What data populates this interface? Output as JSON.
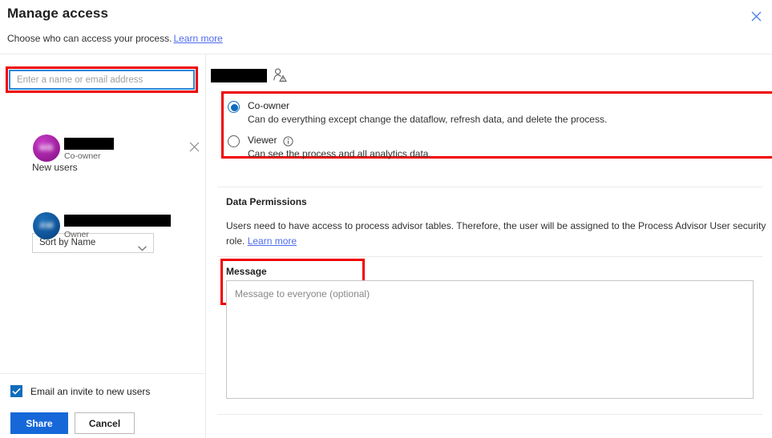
{
  "header": {
    "title": "Manage access",
    "subtitle": "Choose who can access your process.",
    "subtitle_link": "Learn more",
    "close_icon": "close-icon"
  },
  "left_panel": {
    "search": {
      "placeholder": "Enter a name or email address",
      "value": ""
    },
    "new_users_label": "New users",
    "new_users": [
      {
        "avatar_initials": "MB",
        "avatar_color": "#a020a0",
        "name_redacted": true,
        "name_redaction_width": 62,
        "role": "Co-owner",
        "remove_icon": "close-icon"
      }
    ],
    "sort": {
      "selected": "Sort by Name",
      "chevron_icon": "chevron-down-icon"
    },
    "existing_users": [
      {
        "avatar_initials": "AM",
        "avatar_color": "#0f5499",
        "name_redacted": true,
        "name_redaction_width": 133,
        "role": "Owner"
      }
    ],
    "email_invite": {
      "label": "Email an invite to new users",
      "checked": true
    },
    "buttons": {
      "primary": "Share",
      "secondary": "Cancel"
    }
  },
  "right_panel": {
    "selected_user": {
      "name_redacted": true,
      "icon": "person-warning-icon"
    },
    "roles": [
      {
        "id": "co-owner",
        "label": "Co-owner",
        "description": "Can do everything except change the dataflow, refresh data, and delete the process.",
        "selected": true
      },
      {
        "id": "viewer",
        "label": "Viewer",
        "description": "Can see the process and all analytics data.",
        "selected": false,
        "info_icon": "info-icon"
      }
    ],
    "data_permissions": {
      "title": "Data Permissions",
      "text": "Users need to have access to process advisor tables. Therefore, the user will be assigned to the Process Advisor User security role.",
      "link": "Learn more"
    },
    "message": {
      "label": "Message",
      "placeholder": "Message to everyone (optional)",
      "value": ""
    }
  },
  "annotations": {
    "highlight_color": "#ef0000",
    "boxes": [
      "search-input",
      "role-options",
      "message-label"
    ]
  }
}
